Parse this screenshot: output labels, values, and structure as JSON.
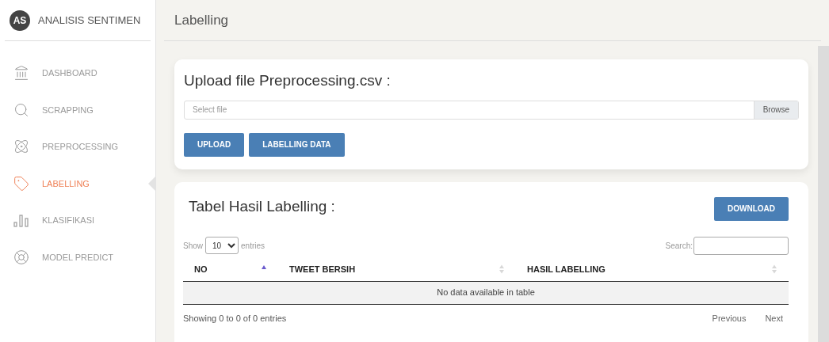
{
  "brand": {
    "initials": "AS",
    "title": "ANALISIS SENTIMEN"
  },
  "sidebar": {
    "items": [
      {
        "label": "DASHBOARD",
        "selected": false
      },
      {
        "label": "SCRAPPING",
        "selected": false
      },
      {
        "label": "PREPROCESSING",
        "selected": false
      },
      {
        "label": "LABELLING",
        "selected": true
      },
      {
        "label": "KLASIFIKASI",
        "selected": false
      },
      {
        "label": "MODEL PREDICT",
        "selected": false
      }
    ]
  },
  "header": {
    "title": "Labelling"
  },
  "upload_card": {
    "title": "Upload file Preprocessing.csv :",
    "file_field": {
      "placeholder": "Select file",
      "browse": "Browse"
    },
    "buttons": [
      "UPLOAD",
      "LABELLING DATA"
    ]
  },
  "table_card": {
    "title": "Tabel Hasil Labelling :",
    "download": "DOWNLOAD",
    "show_label": "Show",
    "page_size": "10",
    "entries_label": "entries",
    "search_label": "Search:",
    "columns": [
      {
        "label": "NO",
        "sorted": true
      },
      {
        "label": "TWEET BERSIH",
        "sorted": false
      },
      {
        "label": "HASIL LABELLING",
        "sorted": false
      }
    ],
    "empty_message": "No data available in table",
    "info": "Showing 0 to 0 of 0 entries",
    "pagination": [
      "Previous",
      "Next"
    ]
  }
}
